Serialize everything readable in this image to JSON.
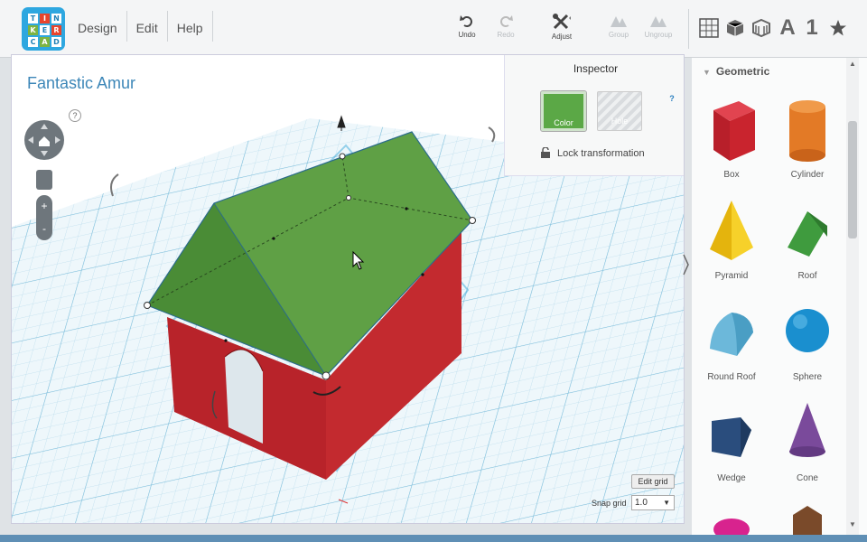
{
  "app": {
    "logo_letters": [
      "T",
      "I",
      "N",
      "K",
      "E",
      "R",
      "C",
      "A",
      "D"
    ],
    "menus": [
      "Design",
      "Edit",
      "Help"
    ]
  },
  "toolbar": {
    "undo": "Undo",
    "redo": "Redo",
    "adjust": "Adjust",
    "group": "Group",
    "ungroup": "Ungroup",
    "right_icons": [
      "grid-icon",
      "cube-icon",
      "hollow-cube-icon",
      "letter-icon",
      "number-icon",
      "star-icon"
    ],
    "letter_label": "A",
    "number_label": "1"
  },
  "workplane": {
    "title": "Fantastic Amur",
    "help": "?",
    "zoom_in": "+",
    "zoom_out": "-",
    "edit_grid": "Edit grid",
    "snap_label": "Snap grid",
    "snap_value": "1.0",
    "snap_arrow": "▼",
    "colors": {
      "roof": "#5fa045",
      "wall": "#c32a2f",
      "grid": "#a8d5e8"
    }
  },
  "inspector": {
    "title": "Inspector",
    "help": "?",
    "color_label": "Color",
    "hole_label": "Hole",
    "lock_label": "Lock transformation"
  },
  "panel": {
    "category": "Geometric",
    "shapes": [
      {
        "label": "Box",
        "color": "#c9242e"
      },
      {
        "label": "Cylinder",
        "color": "#e37a26"
      },
      {
        "label": "Pyramid",
        "color": "#f2c413"
      },
      {
        "label": "Roof",
        "color": "#3f9b3e"
      },
      {
        "label": "Round Roof",
        "color": "#6cb8da"
      },
      {
        "label": "Sphere",
        "color": "#1a8fcf"
      },
      {
        "label": "Wedge",
        "color": "#2a4d7d"
      },
      {
        "label": "Cone",
        "color": "#7a4a9b"
      }
    ]
  }
}
